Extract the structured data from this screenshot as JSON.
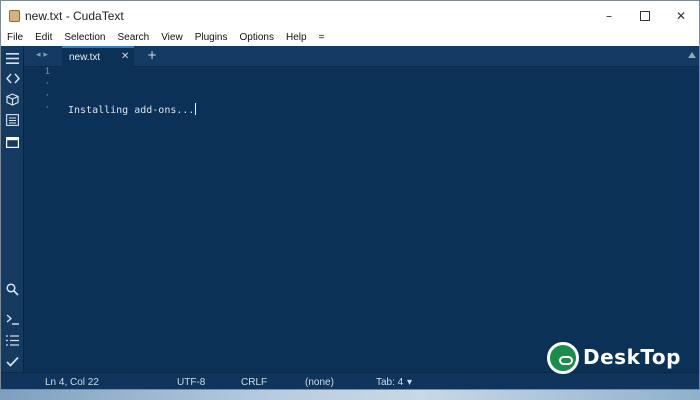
{
  "window": {
    "title": "new.txt - CudaText",
    "controls": {
      "minimize": "–",
      "maximize": "",
      "close": "✕"
    }
  },
  "menu": {
    "items": [
      "File",
      "Edit",
      "Selection",
      "Search",
      "View",
      "Plugins",
      "Options",
      "Help",
      "="
    ]
  },
  "sidebar": {
    "top_icons": [
      "menu-icon",
      "code-icon",
      "package-icon",
      "list-icon",
      "panel-icon"
    ],
    "bottom_icons": [
      "search-icon",
      "terminal-icon",
      "list-lines-icon",
      "check-icon"
    ]
  },
  "tabs": {
    "nav_arrows": "◂ ▸",
    "items": [
      {
        "label": "new.txt",
        "close": "✕",
        "active": true
      }
    ],
    "add_label": "+"
  },
  "editor": {
    "line_numbers": [
      "1",
      "·",
      "·",
      "·"
    ],
    "content": "Installing add-ons..."
  },
  "status": {
    "position": "Ln 4, Col 22",
    "encoding": "UTF-8",
    "line_ending": "CRLF",
    "lexer": "(none)",
    "tab": "Tab: 4",
    "tab_dropdown": "▾"
  },
  "watermark": {
    "text": "DeskTop"
  },
  "colors": {
    "editor_bg": "#0b3157",
    "tab_accent": "#2f7fd0",
    "watermark_green": "#1a8c4e"
  }
}
